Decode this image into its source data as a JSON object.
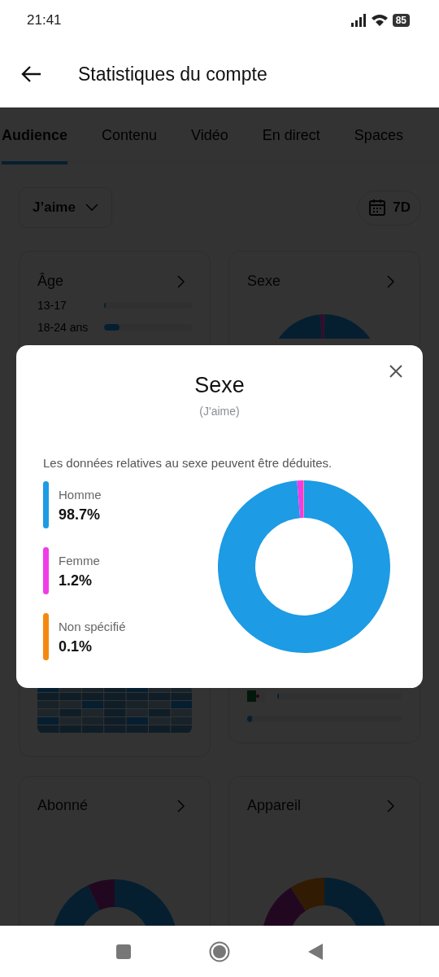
{
  "status_bar": {
    "time": "21:41",
    "battery": "85"
  },
  "header": {
    "title": "Statistiques du compte"
  },
  "tabs": [
    {
      "label": "Audience",
      "selected": true
    },
    {
      "label": "Contenu",
      "selected": false
    },
    {
      "label": "Vidéo",
      "selected": false
    },
    {
      "label": "En direct",
      "selected": false
    },
    {
      "label": "Spaces",
      "selected": false
    }
  ],
  "filter": {
    "label": "J’aime"
  },
  "period": {
    "label": "7D"
  },
  "cards": [
    {
      "kind": "age",
      "title": "Âge",
      "rows": [
        {
          "label": "13-17",
          "level": 0.02
        },
        {
          "label": "18-24 ans",
          "level": 0.18
        }
      ]
    },
    {
      "kind": "gender",
      "title": "Sexe",
      "rows": [
        {
          "kind": "flag",
          "level": 0.01
        },
        {
          "kind": "plain",
          "level": 0.03
        }
      ]
    },
    {
      "kind": "followers",
      "title": "Abonné"
    },
    {
      "kind": "device",
      "title": "Appareil"
    }
  ],
  "modal": {
    "title": "Sexe",
    "subtitle": "(J'aime)",
    "note": "Les données relatives au sexe peuvent être déduites.",
    "legend": [
      {
        "value": "98.7%",
        "color": "#1d9be4"
      },
      {
        "value": "1.2%",
        "color": "#f03ce8"
      },
      {
        "value": "0.1%",
        "color": "#f5890f"
      }
    ],
    "chart_data": {
      "type": "donut",
      "categories": [
        "Homme",
        "Femme",
        "Non spécifié"
      ],
      "series": [
        {
          "values": [
            98.7,
            1.2,
            0.1
          ]
        }
      ]
    }
  }
}
